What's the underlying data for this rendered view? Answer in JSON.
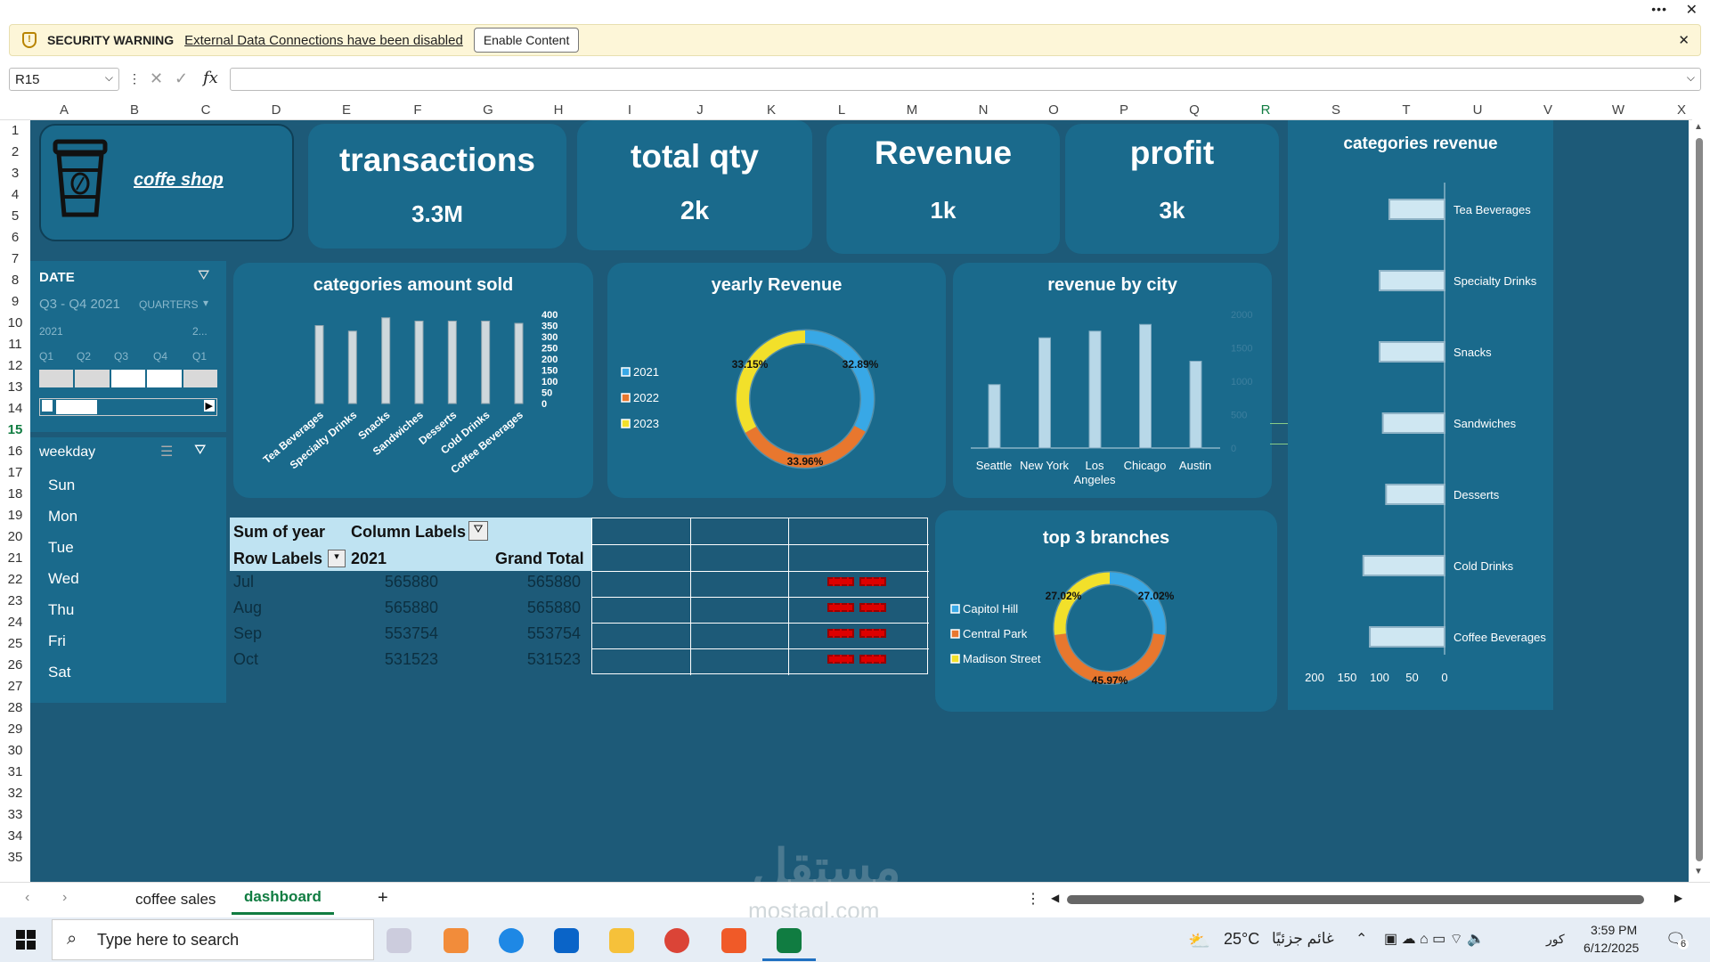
{
  "window": {
    "more": "•••",
    "close": "✕"
  },
  "security": {
    "title": "SECURITY WARNING",
    "message": "External Data Connections have been disabled",
    "button": "Enable Content"
  },
  "formula_bar": {
    "name_box": "R15",
    "fx": "fx",
    "value": ""
  },
  "columns": [
    "A",
    "B",
    "C",
    "D",
    "E",
    "F",
    "G",
    "H",
    "I",
    "J",
    "K",
    "L",
    "M",
    "N",
    "O",
    "P",
    "Q",
    "R",
    "S",
    "T",
    "U",
    "V",
    "W",
    "X"
  ],
  "rows": [
    "1",
    "2",
    "3",
    "4",
    "5",
    "6",
    "7",
    "8",
    "9",
    "10",
    "11",
    "12",
    "13",
    "14",
    "15",
    "16",
    "17",
    "18",
    "19",
    "20",
    "21",
    "22",
    "23",
    "24",
    "25",
    "26",
    "27",
    "28",
    "29",
    "30",
    "31",
    "32",
    "33",
    "34",
    "35"
  ],
  "logo": {
    "text": "coffe shop"
  },
  "kpis": [
    {
      "title": "transactions",
      "value": "3.3M"
    },
    {
      "title": "total qty",
      "value": "2k"
    },
    {
      "title": "Revenue",
      "value": "1k"
    },
    {
      "title": "profit",
      "value": "3k"
    }
  ],
  "date_slicer": {
    "title": "DATE",
    "range": "Q3 - Q4 2021",
    "level": "QUARTERS",
    "years": [
      "2021",
      "2..."
    ],
    "quarters": [
      "Q1",
      "Q2",
      "Q3",
      "Q4",
      "Q1"
    ]
  },
  "weekday_slicer": {
    "title": "weekday",
    "days": [
      "Sun",
      "Mon",
      "Tue",
      "Wed",
      "Thu",
      "Fri",
      "Sat"
    ]
  },
  "charts": {
    "categories_amount_sold": {
      "title": "categories amount sold"
    },
    "yearly_revenue": {
      "title": "yearly Revenue"
    },
    "revenue_by_city": {
      "title": "revenue by city"
    },
    "top_branches": {
      "title": "top 3  branches"
    },
    "categories_revenue": {
      "title": "categories revenue"
    }
  },
  "chart_data": [
    {
      "type": "bar",
      "title": "categories amount sold",
      "categories": [
        "Tea Beverages",
        "Specialty Drinks",
        "Snacks",
        "Sandwiches",
        "Desserts",
        "Cold Drinks",
        "Coffee Beverages"
      ],
      "values": [
        350,
        325,
        385,
        370,
        370,
        370,
        360
      ],
      "yticks": [
        "400",
        "350",
        "300",
        "250",
        "200",
        "150",
        "100",
        "50",
        "0"
      ],
      "ylim": [
        0,
        400
      ]
    },
    {
      "type": "pie",
      "title": "yearly Revenue",
      "categories": [
        "2021",
        "2022",
        "2023"
      ],
      "values": [
        32.89,
        33.96,
        33.15
      ],
      "labels": [
        "32.89%",
        "33.96%",
        "33.15%"
      ],
      "colors": [
        "#38a8e6",
        "#e8772e",
        "#f2e02a"
      ]
    },
    {
      "type": "bar",
      "title": "revenue by city",
      "categories": [
        "Seattle",
        "New York",
        "Los Angeles",
        "Chicago",
        "Austin"
      ],
      "values": [
        950,
        1650,
        1750,
        1850,
        1300
      ],
      "yticks": [
        "2000",
        "1500",
        "1000",
        "500",
        "0"
      ],
      "ylim": [
        0,
        2000
      ]
    },
    {
      "type": "pie",
      "title": "top 3  branches",
      "categories": [
        "Capitol Hill",
        "Central Park",
        "Madison Street"
      ],
      "values": [
        27.02,
        45.97,
        27.02
      ],
      "labels": [
        "27.02%",
        "45.97%",
        "27.02%"
      ],
      "colors": [
        "#38a8e6",
        "#e8772e",
        "#f2e02a"
      ]
    },
    {
      "type": "bar",
      "title": "categories revenue",
      "categories": [
        "Tea Beverages",
        "Specialty Drinks",
        "Snacks",
        "Sandwiches",
        "Desserts",
        "Cold Drinks",
        "Coffee Beverages"
      ],
      "values": [
        85,
        100,
        100,
        95,
        90,
        125,
        115
      ],
      "xticks": [
        "200",
        "150",
        "100",
        "50",
        "0"
      ],
      "xlim": [
        0,
        200
      ]
    }
  ],
  "pivot": {
    "sum_label": "Sum of year",
    "col_labels": "Column Labels",
    "row_labels": "Row Labels",
    "year": "2021",
    "grand_total": "Grand Total",
    "rows": [
      {
        "month": "Jul",
        "v": "565880",
        "t": "565880"
      },
      {
        "month": "Aug",
        "v": "565880",
        "t": "565880"
      },
      {
        "month": "Sep",
        "v": "553754",
        "t": "553754"
      },
      {
        "month": "Oct",
        "v": "531523",
        "t": "531523"
      }
    ]
  },
  "tabs": {
    "sheet1": "coffee sales",
    "sheet2": "dashboard",
    "add": "+"
  },
  "taskbar": {
    "search": "Type here to search",
    "weather": "25°C",
    "weather_text": "غائم جزئيًا",
    "lang": "كور",
    "time": "3:59 PM",
    "date": "6/12/2025",
    "notif": "6"
  },
  "watermark": {
    "text": "مستقل",
    "sub": "mostaql.com"
  }
}
